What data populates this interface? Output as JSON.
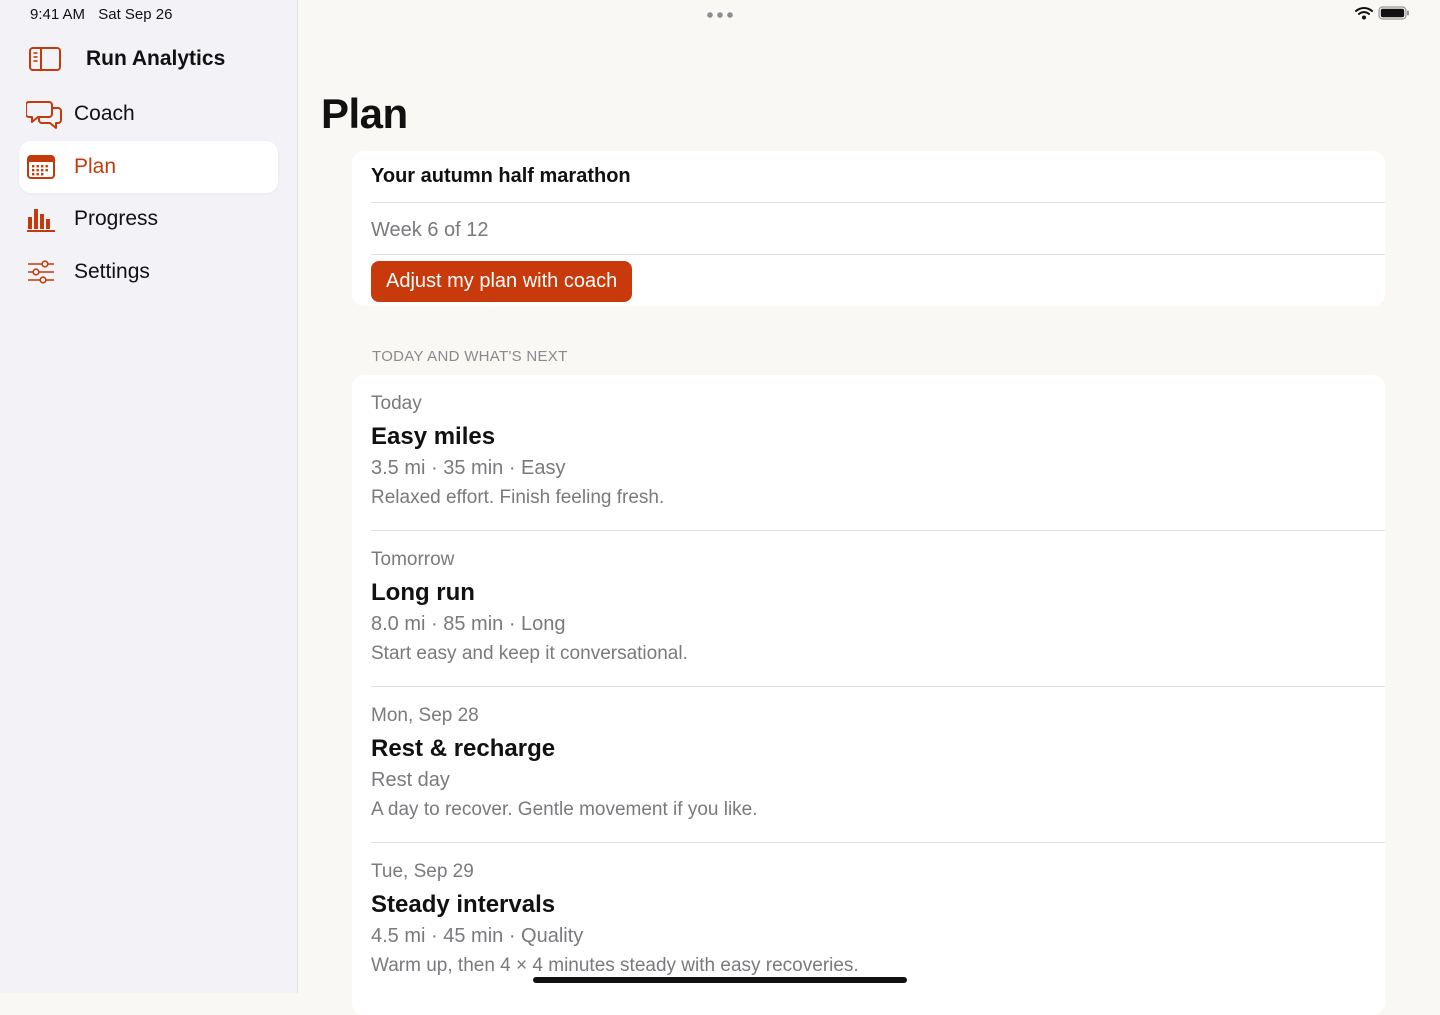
{
  "status_bar": {
    "time": "9:41 AM",
    "date": "Sat Sep 26"
  },
  "sidebar": {
    "app_title": "Run Analytics",
    "accent": "#C43A0C",
    "items": [
      {
        "label": "Coach",
        "icon": "chat-bubbles-icon",
        "selected": false
      },
      {
        "label": "Plan",
        "icon": "calendar-icon",
        "selected": true
      },
      {
        "label": "Progress",
        "icon": "bar-chart-icon",
        "selected": false
      },
      {
        "label": "Settings",
        "icon": "sliders-icon",
        "selected": false
      }
    ]
  },
  "main": {
    "title": "Plan",
    "plan_card": {
      "title": "Your autumn half marathon",
      "week": "Week 6 of 12",
      "button_label": "Adjust my plan with coach",
      "button_color": "#C83A0C"
    },
    "section_header": "TODAY AND WHAT'S NEXT",
    "sessions": [
      {
        "day": "Today",
        "title": "Easy miles",
        "meta": "3.5 mi · 35 min · Easy",
        "note": "Relaxed effort. Finish feeling fresh."
      },
      {
        "day": "Tomorrow",
        "title": "Long run",
        "meta": "8.0 mi · 85 min · Long",
        "note": "Start easy and keep it conversational."
      },
      {
        "day": "Mon, Sep 28",
        "title": "Rest & recharge",
        "meta": "Rest day",
        "note": "A day to recover. Gentle movement if you like."
      },
      {
        "day": "Tue, Sep 29",
        "title": "Steady intervals",
        "meta": "4.5 mi · 45 min · Quality",
        "note": "Warm up, then 4 × 4 minutes steady with easy recoveries."
      }
    ]
  }
}
